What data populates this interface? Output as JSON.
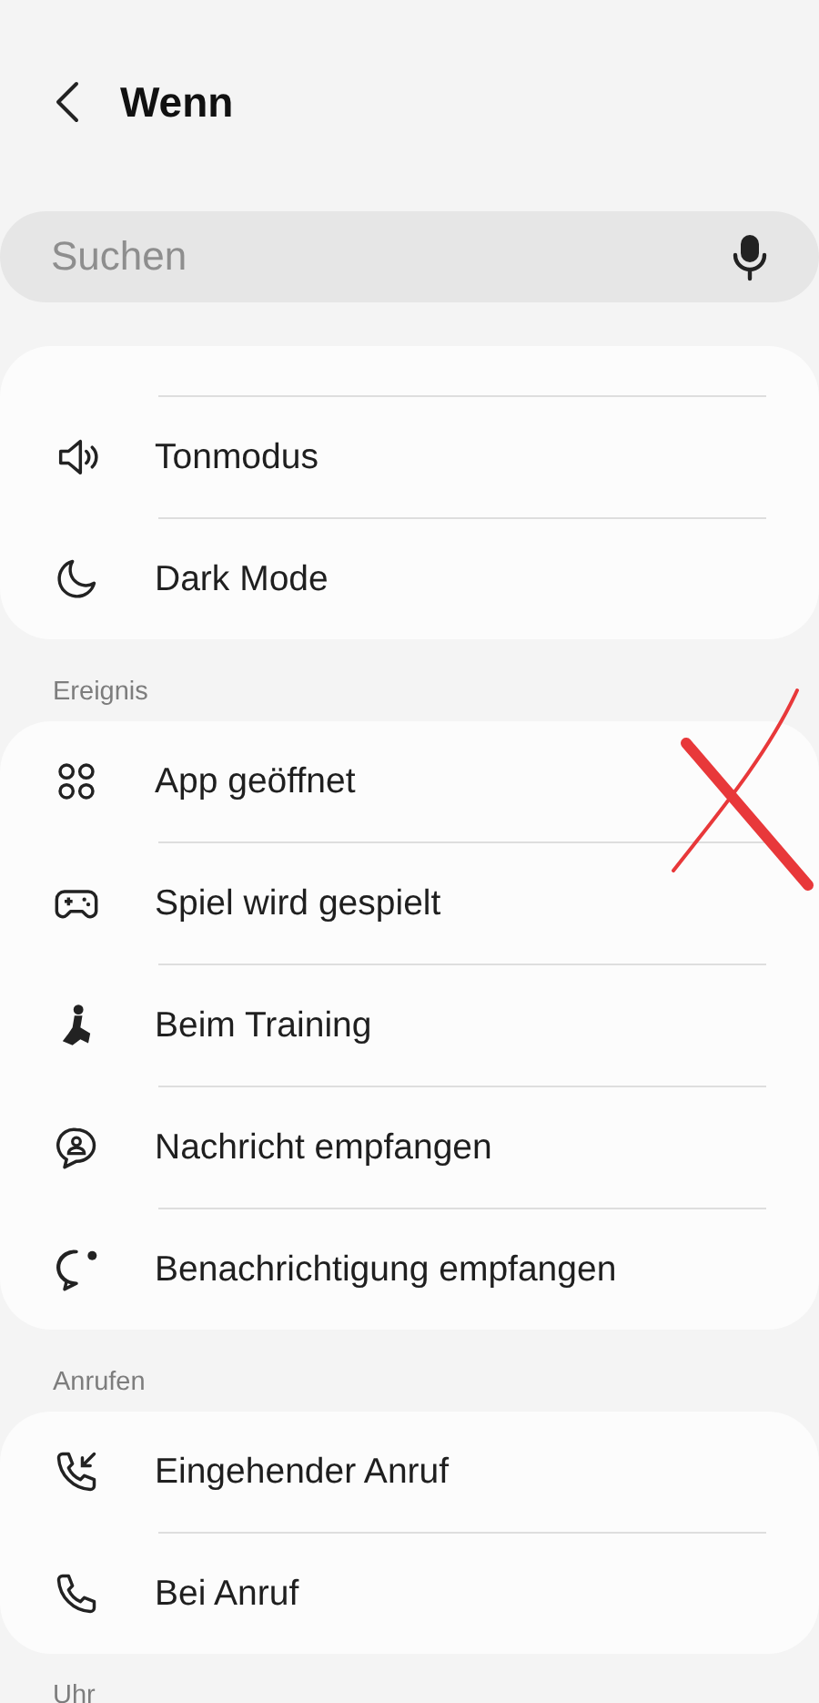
{
  "header": {
    "title": "Wenn"
  },
  "search": {
    "placeholder": "Suchen"
  },
  "sections": [
    {
      "items": [
        "Tonmodus",
        "Dark Mode"
      ]
    },
    {
      "title": "Ereignis",
      "items": [
        "App geöffnet",
        "Spiel wird gespielt",
        "Beim Training",
        "Nachricht empfangen",
        "Benachrichtigung empfangen"
      ]
    },
    {
      "title": "Anrufen",
      "items": [
        "Eingehender Anruf",
        "Bei Anruf"
      ]
    },
    {
      "title": "Uhr"
    }
  ]
}
